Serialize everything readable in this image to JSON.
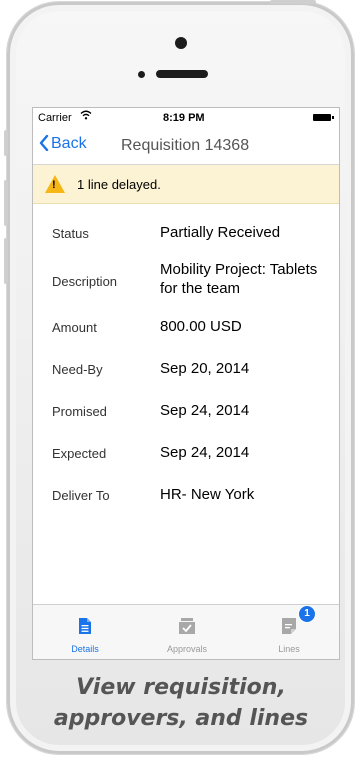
{
  "status_bar": {
    "carrier": "Carrier",
    "wifi_icon": "wifi-icon",
    "time": "8:19 PM",
    "battery_icon": "battery-icon"
  },
  "nav": {
    "back_label": "Back",
    "title": "Requisition 14368"
  },
  "alert": {
    "icon": "warning-icon",
    "icon_glyph": "!",
    "message": "1 line delayed.",
    "background": "#fbf3d4",
    "icon_color": "#f6b716"
  },
  "details": [
    {
      "label": "Status",
      "value": "Partially Received"
    },
    {
      "label": "Description",
      "value": "Mobility Project: Tablets for the team"
    },
    {
      "label": "Amount",
      "value": "800.00 USD"
    },
    {
      "label": "Need-By",
      "value": "Sep 20, 2014"
    },
    {
      "label": "Promised",
      "value": "Sep 24, 2014"
    },
    {
      "label": "Expected",
      "value": "Sep 24, 2014"
    },
    {
      "label": "Deliver To",
      "value": "HR- New York"
    }
  ],
  "tabs": [
    {
      "label": "Details",
      "icon": "document-icon",
      "active": true
    },
    {
      "label": "Approvals",
      "icon": "approval-tray-icon",
      "active": false
    },
    {
      "label": "Lines",
      "icon": "lines-icon",
      "badge": "1",
      "active": false
    }
  ],
  "caption": {
    "line1": "View requisition,",
    "line2": "approvers, and lines"
  },
  "colors": {
    "accent": "#1a73e8",
    "caption": "#555555"
  }
}
